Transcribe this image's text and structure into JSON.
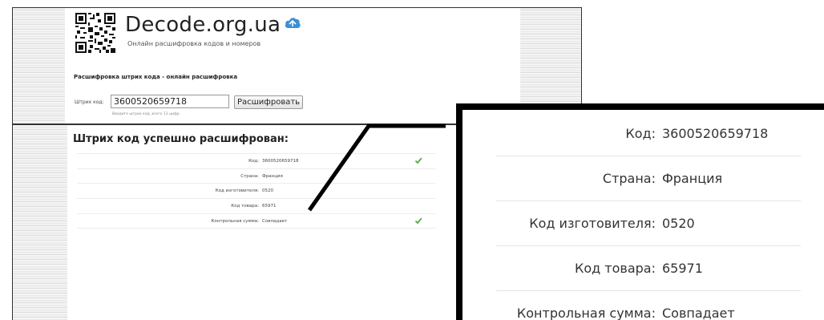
{
  "site": {
    "title": "Decode.org.ua",
    "subtitle": "Онлайн расшифровка кодов и номеров"
  },
  "form": {
    "heading": "Расшифровка штрих кода - онлайн расшифровка",
    "label": "Штрих код:",
    "value": "3600520659718",
    "button": "Расшифровать",
    "hint": "Введите штрих код, всего 13 цифр"
  },
  "result": {
    "heading": "Штрих код успешно расшифрован:",
    "rows": [
      {
        "label": "Код:",
        "value": "3600520659718",
        "check": true
      },
      {
        "label": "Страна:",
        "value": "Франция",
        "check": false
      },
      {
        "label": "Код изготовителя:",
        "value": "0520",
        "check": false
      },
      {
        "label": "Код товара:",
        "value": "65971",
        "check": false
      },
      {
        "label": "Контрольная сумма:",
        "value": "Совпадает",
        "check": true
      }
    ]
  },
  "colors": {
    "check": "#5aa846",
    "cloud": "#3b8fd6"
  },
  "icons": {
    "qr": "qr-code-icon",
    "cloud": "cloud-icon",
    "check": "checkmark-icon"
  }
}
